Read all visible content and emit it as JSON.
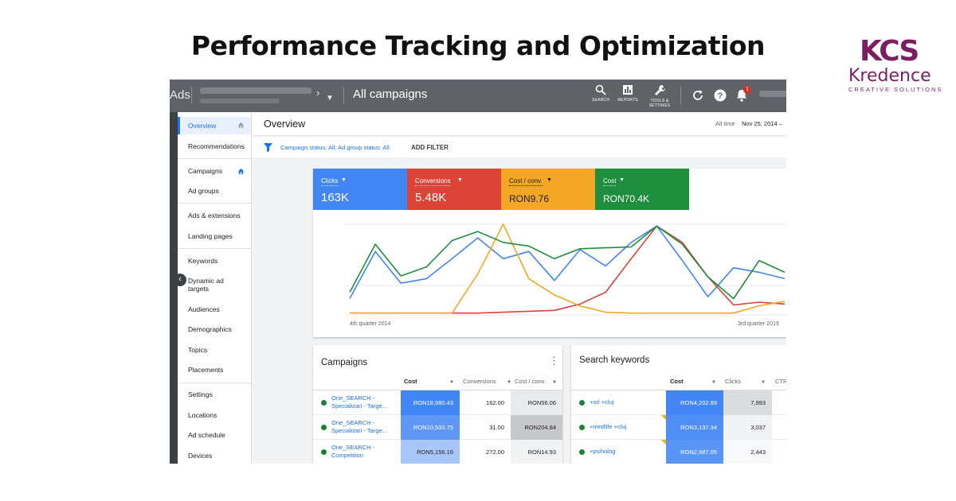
{
  "headline": "Performance Tracking and Optimization",
  "logo": {
    "mark": "KCS",
    "name": "Kredence",
    "tagline": "CREATIVE SOLUTIONS",
    "color": "#7b1f62"
  },
  "topbar": {
    "product": "Ads",
    "title": "All campaigns",
    "tools": [
      {
        "label": "SEARCH",
        "icon": "search-icon"
      },
      {
        "label": "REPORTS",
        "icon": "reports-icon"
      },
      {
        "label": "TOOLS & SETTINGS",
        "icon": "wrench-icon"
      }
    ],
    "notification_badge": "!"
  },
  "sidebar": {
    "items": [
      {
        "label": "Overview",
        "active": true,
        "icon": "home-icon"
      },
      {
        "label": "Recommendations"
      },
      {
        "label": "Campaigns",
        "icon": "home-icon"
      },
      {
        "label": "Ad groups"
      },
      {
        "label": "Ads & extensions"
      },
      {
        "label": "Landing pages"
      },
      {
        "label": "Keywords"
      },
      {
        "label": "Dynamic ad targets"
      },
      {
        "label": "Audiences"
      },
      {
        "label": "Demographics"
      },
      {
        "label": "Topics"
      },
      {
        "label": "Placements"
      },
      {
        "label": "Settings"
      },
      {
        "label": "Locations"
      },
      {
        "label": "Ad schedule"
      },
      {
        "label": "Devices"
      }
    ]
  },
  "header": {
    "title": "Overview",
    "range_label": "All time",
    "date": "Nov 25, 2014 –"
  },
  "filter": {
    "text": "Campaign status: All; Ad group status: All",
    "add": "ADD FILTER"
  },
  "metrics": [
    {
      "label": "Clicks",
      "value": "163K",
      "color": "#4285f4"
    },
    {
      "label": "Conversions",
      "value": "5.48K",
      "color": "#db4437"
    },
    {
      "label": "Cost / conv.",
      "value": "RON9.76",
      "color": "#f4a725"
    },
    {
      "label": "Cost",
      "value": "RON70.4K",
      "color": "#1e8e3e"
    }
  ],
  "chart_data": {
    "type": "line",
    "x_start_label": "4th quarter 2014",
    "x_end_label": "3rd quarter 2019",
    "grid": true,
    "series": [
      {
        "name": "Clicks",
        "color": "#4285f4",
        "values": [
          18,
          70,
          35,
          40,
          62,
          85,
          62,
          70,
          38,
          72,
          54,
          80,
          98,
          60,
          20,
          52,
          47,
          40
        ]
      },
      {
        "name": "Conversions",
        "color": "#db4437",
        "values": [
          2,
          2,
          2,
          2,
          2,
          2,
          3,
          4,
          5,
          12,
          25,
          62,
          98,
          80,
          42,
          11,
          14,
          12
        ]
      },
      {
        "name": "Cost / conv.",
        "color": "#f4a725",
        "values": [
          2,
          2,
          2,
          2,
          2,
          45,
          100,
          40,
          22,
          10,
          3,
          2,
          2,
          2,
          2,
          2,
          10,
          15
        ]
      },
      {
        "name": "Cost",
        "color": "#1e8e3e",
        "values": [
          25,
          78,
          43,
          53,
          82,
          92,
          80,
          76,
          62,
          73,
          74,
          75,
          98,
          78,
          42,
          18,
          60,
          47
        ]
      }
    ]
  },
  "campaigns_card": {
    "title": "Campaigns",
    "columns": [
      "Cost",
      "Conversions",
      "Cost / conv."
    ],
    "rows": [
      {
        "name": "One_SEARCH - Specializari - Targe...",
        "cost": "RON18,980.43",
        "conversions": "162.00",
        "cpc": "RON56.06"
      },
      {
        "name": "One_SEARCH - Specializari - Targe...",
        "cost": "RON10,533.75",
        "conversions": "31.00",
        "cpc": "RON204.84"
      },
      {
        "name": "One_SEARCH - Competition",
        "cost": "RON5,156.16",
        "conversions": "272.00",
        "cpc": "RON14.93"
      }
    ]
  },
  "keywords_card": {
    "title": "Search keywords",
    "columns": [
      "Cost",
      "Clicks",
      "CTR"
    ],
    "rows": [
      {
        "name": "+orl +cluj",
        "cost": "RON4,202.89",
        "clicks": "7,993"
      },
      {
        "name": "+medlife +cluj",
        "cost": "RON3,137.34",
        "clicks": "3,037"
      },
      {
        "name": "+psiholog",
        "cost": "RON2,987.05",
        "clicks": "2,443"
      }
    ]
  }
}
